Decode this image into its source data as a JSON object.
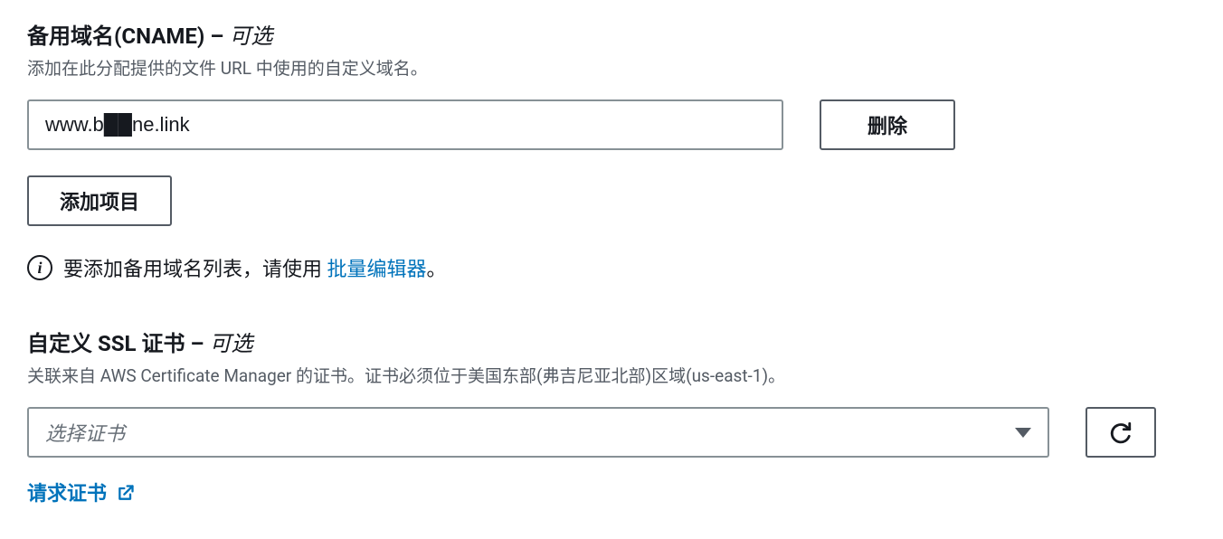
{
  "cname": {
    "title_main": "备用域名(CNAME)",
    "title_sep": " – ",
    "title_optional": "可选",
    "description": "添加在此分配提供的文件 URL 中使用的自定义域名。",
    "value": "www.b██ne.link",
    "delete_label": "删除",
    "add_label": "添加项目",
    "info_prefix": "要添加备用域名列表，请使用 ",
    "info_link": "批量编辑器",
    "info_suffix": "。"
  },
  "ssl": {
    "title_main": "自定义 SSL 证书",
    "title_sep": " – ",
    "title_optional": "可选",
    "description": "关联来自 AWS Certificate Manager 的证书。证书必须位于美国东部(弗吉尼亚北部)区域(us-east-1)。",
    "placeholder": "选择证书",
    "request_link": "请求证书"
  }
}
